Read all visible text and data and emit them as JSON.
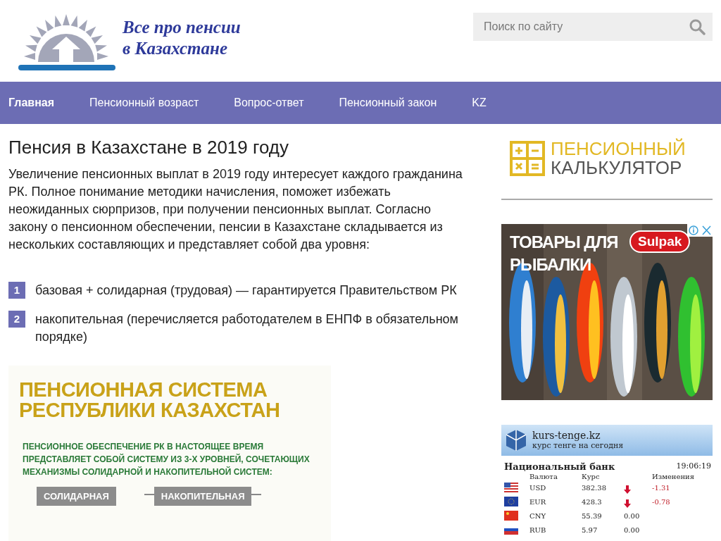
{
  "header": {
    "logo_text": [
      "Все про пенсии",
      "в Казахстане"
    ],
    "search": {
      "placeholder": "Поиск по сайту"
    }
  },
  "nav": [
    {
      "label": "Главная",
      "selected": true
    },
    {
      "label": "Пенсионный возраст",
      "selected": false
    },
    {
      "label": "Вопрос-ответ",
      "selected": false
    },
    {
      "label": "Пенсионный закон",
      "selected": false
    },
    {
      "label": "KZ",
      "selected": false
    }
  ],
  "article": {
    "title": "Пенсия в Казахстане в 2019 году",
    "intro": "Увеличение пенсионных выплат в 2019 году интересует каждого гражданина РК. Полное понимание методики начисления, поможет избежать неожиданных сюрпризов, при получении пенсионных выплат. Согласно закону о пенсионном обеспечении, пенсии в Казахстане складывается из нескольких  составляющих и представляет собой два уровня:",
    "list": [
      {
        "number": "1",
        "text": "базовая + солидарная (трудовая) — гарантируется Правительством РК"
      },
      {
        "number": "2",
        "text": "накопительная (перечисляется работодателем в ЕНПФ в обязательном порядке)"
      }
    ],
    "infographic": {
      "title": [
        "ПЕНСИОННАЯ СИСТЕМА",
        "РЕСПУБЛИКИ КАЗАХСТАН"
      ],
      "text": [
        "ПЕНСИОННОЕ ОБЕСПЕЧЕНИЕ РК В НАСТОЯЩЕЕ ВРЕМЯ",
        "ПРЕДСТАВЛЯЕТ СОБОЙ СИСТЕМУ ИЗ 3-Х УРОВНЕЙ, СОЧЕТАЮЩИХ",
        "МЕХАНИЗМЫ СОЛИДАРНОЙ И НАКОПИТЕЛЬНОЙ СИСТЕМ:"
      ],
      "boxes": [
        "СОЛИДАРНАЯ",
        "НАКОПИТЕЛЬНАЯ"
      ]
    }
  },
  "sidebar": {
    "calculator_banner": [
      "ПЕНСИОННЫЙ",
      "КАЛЬКУЛЯТОР"
    ],
    "ad": {
      "kind": "picture",
      "headline": [
        "ТОВАРЫ ДЛЯ",
        "РЫБАЛКИ"
      ],
      "brand": "Sulpak"
    },
    "rates_widget": {
      "site": "kurs-tenge.kz",
      "subtitle": "курс тенге на сегодня",
      "bank": "Национальный банк",
      "time": "19:06:19",
      "columns": [
        "Валюта",
        "Курс",
        "Изменения"
      ],
      "rows": [
        {
          "code": "USD",
          "rate": "382.38",
          "falling": true,
          "change": "-1.31"
        },
        {
          "code": "EUR",
          "rate": "428.3",
          "falling": true,
          "change": "-0.78"
        },
        {
          "code": "CNY",
          "rate": "55.39",
          "falling": false,
          "change": "0.00"
        },
        {
          "code": "RUB",
          "rate": "5.97",
          "falling": false,
          "change": "0.00"
        }
      ]
    }
  }
}
